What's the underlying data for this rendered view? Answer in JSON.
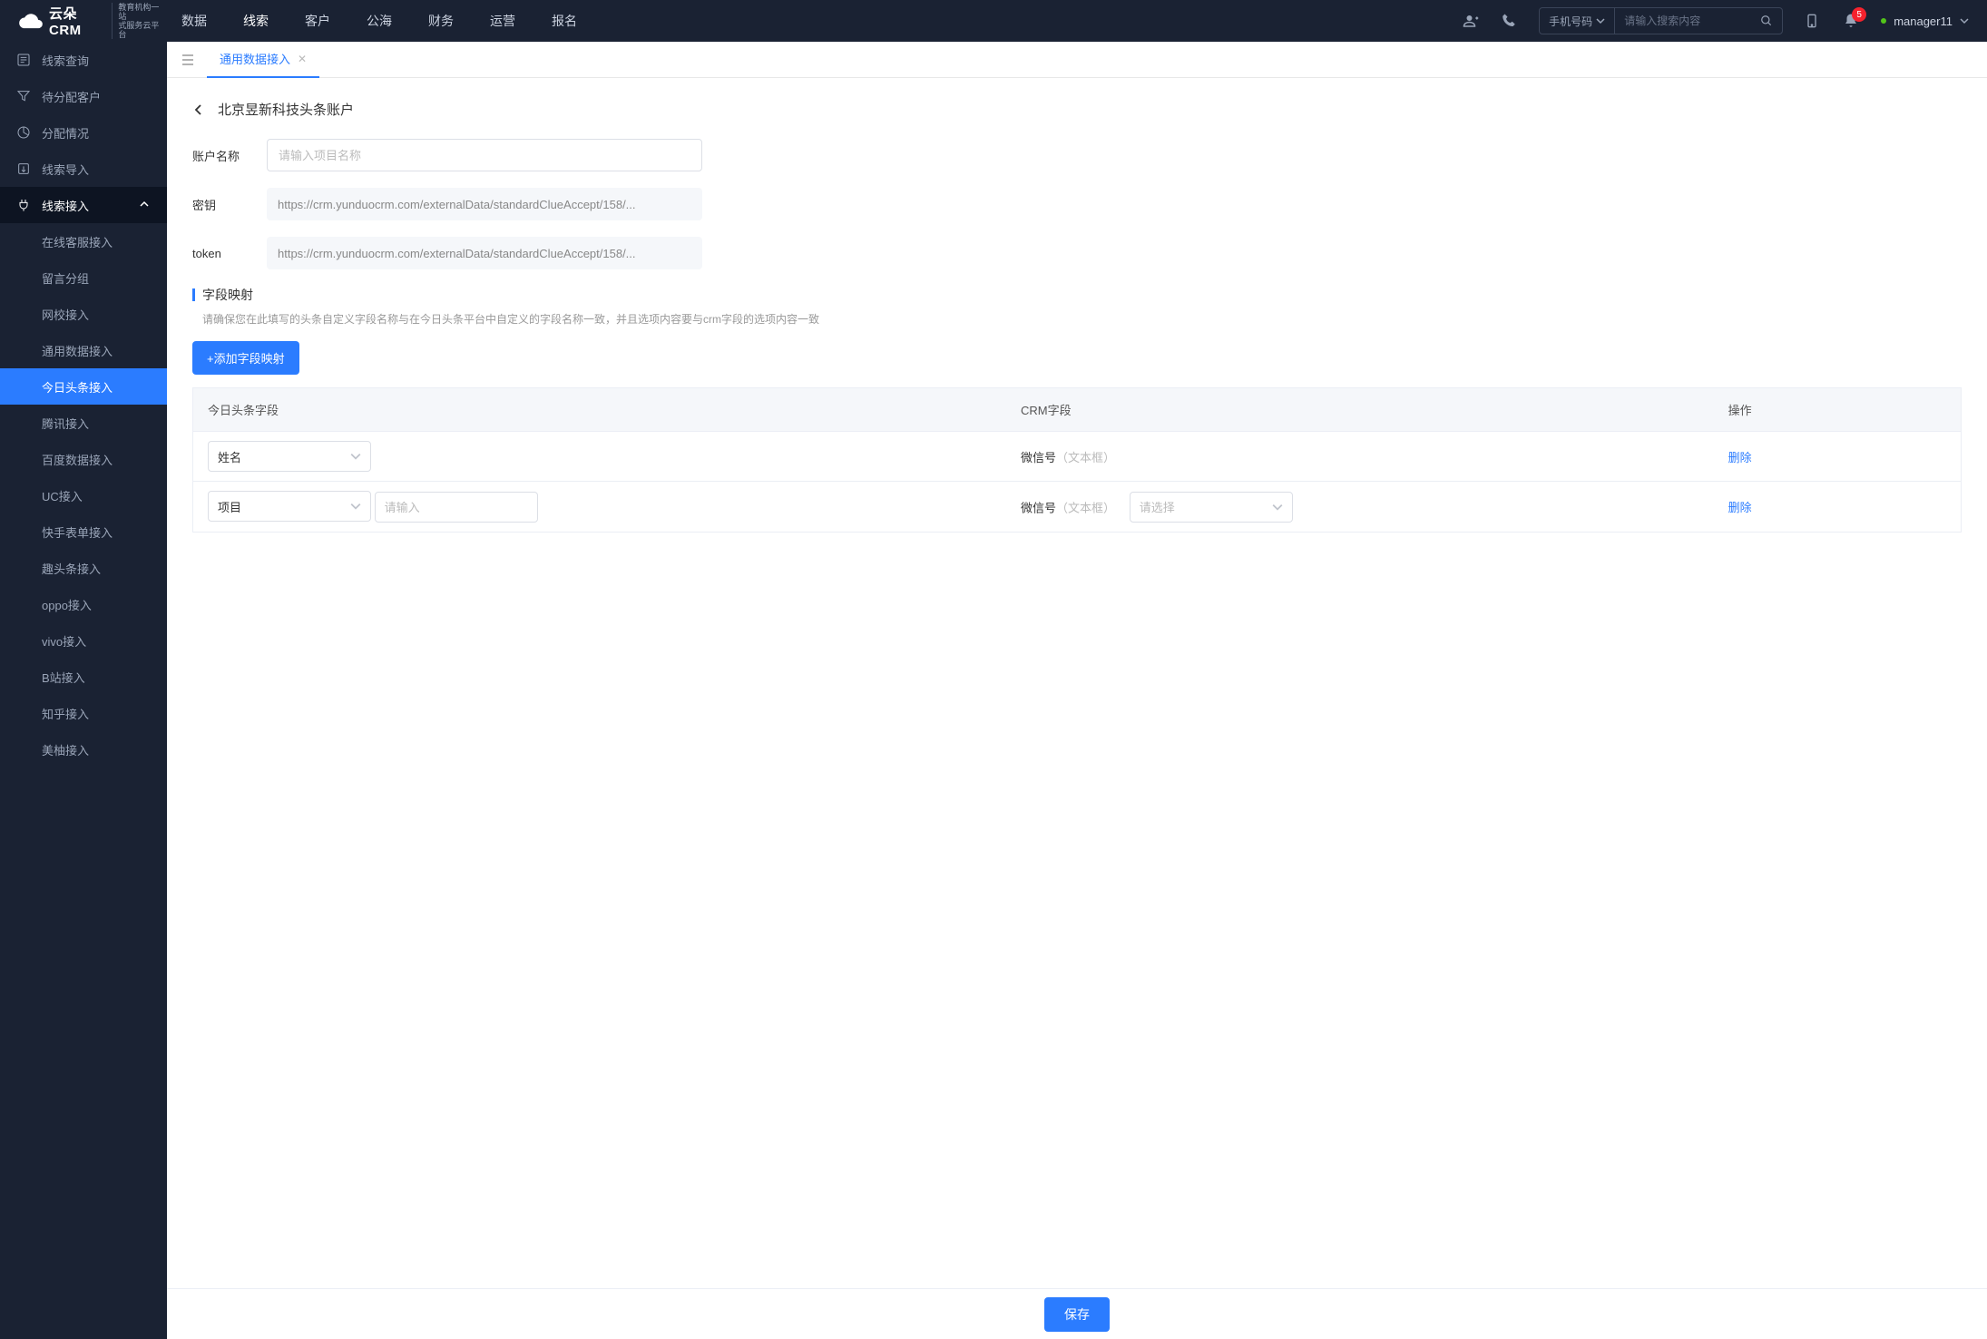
{
  "logo": {
    "brand": "云朵CRM",
    "sub1": "教育机构一站",
    "sub2": "式服务云平台",
    "url": "www.yunduocrm.com"
  },
  "topnav": {
    "items": [
      "数据",
      "线索",
      "客户",
      "公海",
      "财务",
      "运营",
      "报名"
    ],
    "active": 1
  },
  "search": {
    "selector": "手机号码",
    "placeholder": "请输入搜索内容"
  },
  "notif": {
    "count": "5"
  },
  "user": {
    "name": "manager11"
  },
  "sidebar": {
    "items": [
      {
        "label": "线索查询",
        "icon": "list"
      },
      {
        "label": "待分配客户",
        "icon": "filter"
      },
      {
        "label": "分配情况",
        "icon": "pie"
      },
      {
        "label": "线索导入",
        "icon": "export"
      },
      {
        "label": "线索接入",
        "icon": "plug",
        "expanded": true,
        "children": [
          "在线客服接入",
          "留言分组",
          "网校接入",
          "通用数据接入",
          "今日头条接入",
          "腾讯接入",
          "百度数据接入",
          "UC接入",
          "快手表单接入",
          "趣头条接入",
          "oppo接入",
          "vivo接入",
          "B站接入",
          "知乎接入",
          "美柚接入"
        ],
        "activeChild": 4
      }
    ]
  },
  "tab": {
    "label": "通用数据接入"
  },
  "page": {
    "title": "北京昱新科技头条账户",
    "form": {
      "name_label": "账户名称",
      "name_placeholder": "请输入项目名称",
      "key_label": "密钥",
      "key_value": "https://crm.yunduocrm.com/externalData/standardClueAccept/158/...",
      "token_label": "token",
      "token_value": "https://crm.yunduocrm.com/externalData/standardClueAccept/158/..."
    },
    "mapping": {
      "section_title": "字段映射",
      "desc": "请确保您在此填写的头条自定义字段名称与在今日头条平台中自定义的字段名称一致，并且选项内容要与crm字段的选项内容一致",
      "add_btn": "+添加字段映射",
      "cols": {
        "a": "今日头条字段",
        "b": "CRM字段",
        "c": "操作"
      },
      "rows": [
        {
          "tt_sel": "姓名",
          "crm_field": "微信号",
          "crm_type": "（文本框）",
          "has_extra": false
        },
        {
          "tt_sel": "项目",
          "tt_extra_placeholder": "请输入",
          "crm_field": "微信号",
          "crm_type": "（文本框）",
          "crm_sel_placeholder": "请选择",
          "has_extra": true
        }
      ],
      "del": "删除"
    },
    "save": "保存"
  }
}
